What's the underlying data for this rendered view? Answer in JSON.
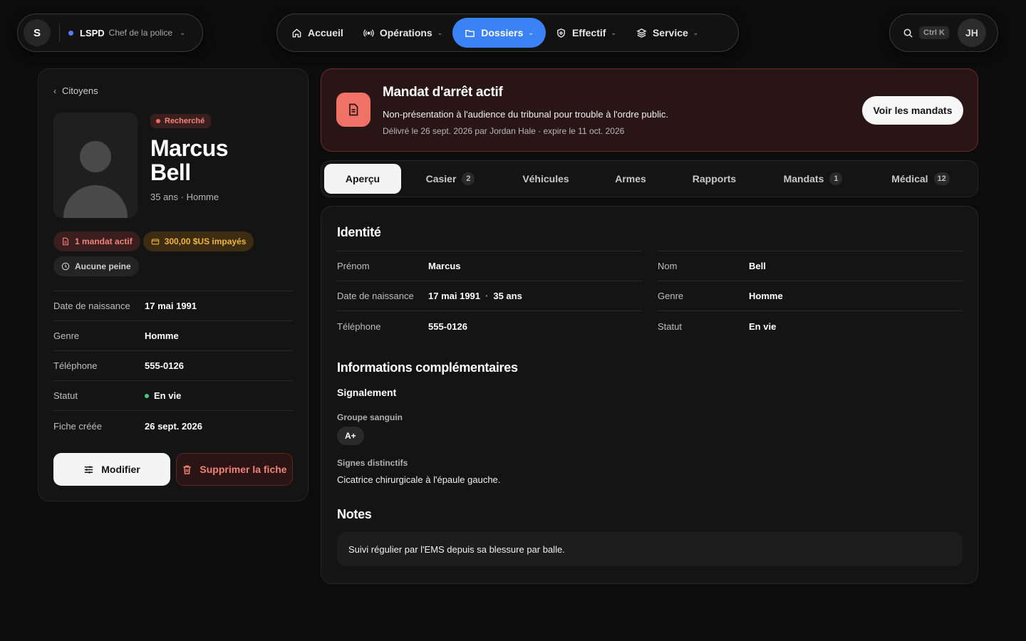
{
  "brand": {
    "logo": "S",
    "org": "LSPD",
    "role": "Chef de la police"
  },
  "nav": {
    "accueil": "Accueil",
    "operations": "Opérations",
    "dossiers": "Dossiers",
    "effectif": "Effectif",
    "service": "Service"
  },
  "tools": {
    "shortcut": "Ctrl K",
    "user_initials": "JH"
  },
  "profile": {
    "back_label": "Citoyens",
    "wanted_badge": "Recherché",
    "first_name": "Marcus",
    "last_name": "Bell",
    "meta": "35 ans · Homme",
    "tags": {
      "warrants": "1 mandat actif",
      "fines": "300,00 $US impayés",
      "sentence": "Aucune peine"
    },
    "rows": [
      {
        "label": "Date de naissance",
        "value": "17 mai 1991"
      },
      {
        "label": "Genre",
        "value": "Homme"
      },
      {
        "label": "Téléphone",
        "value": "555-0126"
      },
      {
        "label": "Statut",
        "value": "En vie"
      },
      {
        "label": "Fiche créée",
        "value": "26 sept. 2026"
      }
    ],
    "modify_label": "Modifier",
    "delete_label": "Supprimer la fiche"
  },
  "alert": {
    "title": "Mandat d'arrêt actif",
    "description": "Non-présentation à l'audience du tribunal pour trouble à l'ordre public.",
    "meta": "Délivré le 26 sept. 2026 par Jordan Hale · expire le 11 oct. 2026",
    "button": "Voir les mandats"
  },
  "tabs": [
    {
      "label": "Aperçu",
      "count": ""
    },
    {
      "label": "Casier",
      "count": "2"
    },
    {
      "label": "Véhicules",
      "count": ""
    },
    {
      "label": "Armes",
      "count": ""
    },
    {
      "label": "Rapports",
      "count": ""
    },
    {
      "label": "Mandats",
      "count": "1"
    },
    {
      "label": "Médical",
      "count": "12"
    }
  ],
  "identity": {
    "title": "Identité",
    "left": [
      {
        "label": "Prénom",
        "value": "Marcus"
      },
      {
        "label": "Date de naissance",
        "value": "17 mai 1991",
        "extra": "35 ans"
      },
      {
        "label": "Téléphone",
        "value": "555-0126"
      }
    ],
    "right": [
      {
        "label": "Nom",
        "value": "Bell"
      },
      {
        "label": "Genre",
        "value": "Homme"
      },
      {
        "label": "Statut",
        "value": "En vie"
      }
    ]
  },
  "extra": {
    "title": "Informations complémentaires",
    "subtitle": "Signalement",
    "blood_label": "Groupe sanguin",
    "blood_value": "A+",
    "marks_label": "Signes distinctifs",
    "marks_value": "Cicatrice chirurgicale à l'épaule gauche."
  },
  "notes": {
    "title": "Notes",
    "text": "Suivi régulier par l'EMS depuis sa blessure par balle."
  },
  "colors": {
    "accent": "#3b82f6",
    "danger": "#f07166",
    "warning": "#f2b43e",
    "success": "#3ecf7d"
  }
}
